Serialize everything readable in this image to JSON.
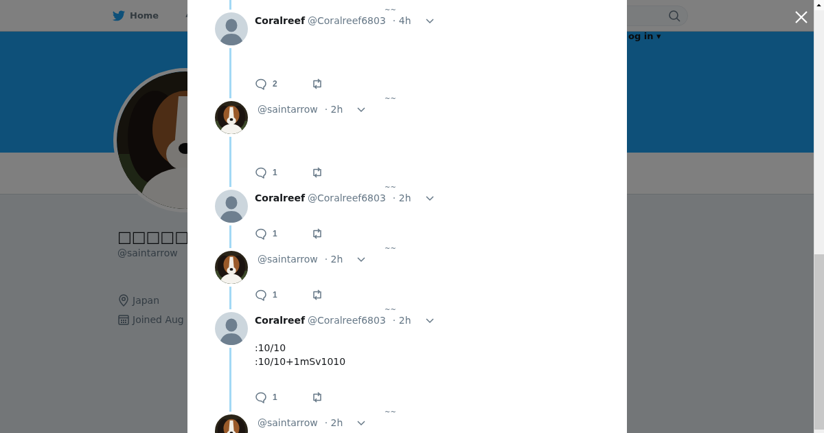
{
  "background_page": {
    "nav": {
      "home_label": "Home",
      "login_label": "og in ▾"
    },
    "profile": {
      "display_name": "□□□□□",
      "handle": "@saintarrow",
      "location": "Japan",
      "joined": "Joined Aug"
    }
  },
  "modal": {
    "tweets": [
      {
        "kind": "empty_body",
        "avatar": {
          "kind": "default"
        },
        "name": "Coralreef",
        "handle": "@Coralreef6803",
        "time": "· 4h",
        "mark": "~~",
        "replies": "2"
      },
      {
        "kind": "empty_body",
        "handle": "@saintarrow",
        "time": "· 2h",
        "mark": "~~",
        "replies": "1"
      },
      {
        "kind": "compact",
        "avatar": {
          "kind": "default"
        },
        "name": "Coralreef",
        "handle": "@Coralreef6803",
        "time": "· 2h",
        "mark": "~~",
        "replies": "1"
      },
      {
        "kind": "compact",
        "handle": "@saintarrow",
        "time": "· 2h",
        "mark": "~~",
        "replies": "1"
      },
      {
        "kind": "text",
        "avatar": {
          "kind": "default"
        },
        "name": "Coralreef",
        "handle": "@Coralreef6803",
        "time": "· 2h",
        "mark": "~~",
        "lines": [
          ":10/10",
          ":10/10+1mSv1010"
        ],
        "replies": "1"
      },
      {
        "kind": "compact",
        "handle": "@saintarrow",
        "time": "· 2h",
        "mark": "~~"
      }
    ]
  }
}
